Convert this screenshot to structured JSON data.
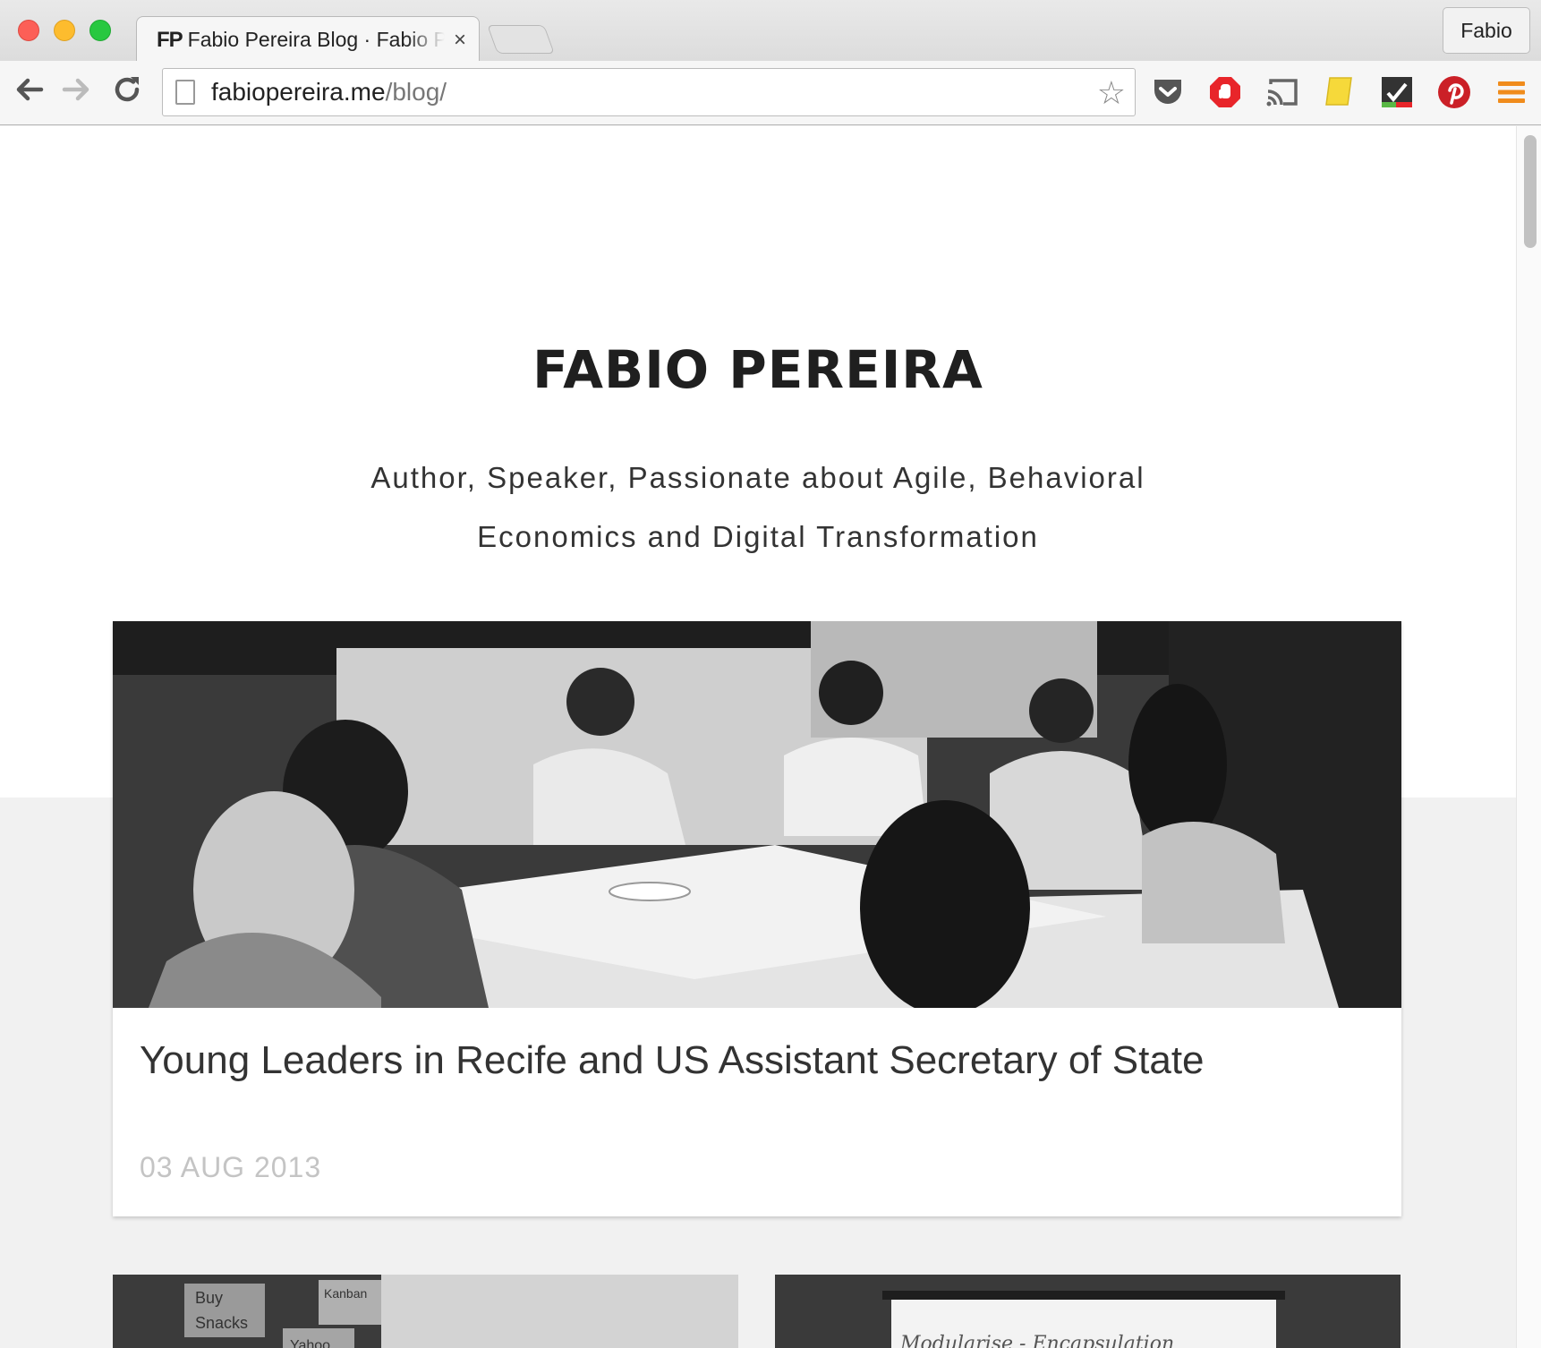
{
  "browser": {
    "tab": {
      "favicon_text": "FP",
      "title": "Fabio Pereira Blog · Fabio P",
      "close_label": "×"
    },
    "profile_name": "Fabio",
    "url_host": "fabiopereira.me",
    "url_path": "/blog/",
    "extensions": [
      "pocket-icon",
      "adblock-stop-icon",
      "cast-icon",
      "sticky-note-icon",
      "checklist-icon",
      "pinterest-icon",
      "menu-icon"
    ]
  },
  "site": {
    "title": "FABIO PEREIRA",
    "tagline": "Author, Speaker, Passionate about Agile, Behavioral Economics and Digital Transformation"
  },
  "featured_post": {
    "title": "Young Leaders in Recife and US Assistant Secretary of State",
    "date": "03 AUG 2013"
  },
  "more_posts": {
    "left_image_text": [
      "Buy",
      "Snacks",
      "Kanban",
      "Yahoo"
    ],
    "right_image_text": "Modularise - Encapsulation"
  },
  "colors": {
    "accent_red": "#e8252a",
    "pinterest": "#cb2027",
    "menu_orange": "#f08c1c",
    "title_text": "#1f1f1f",
    "date_text": "#c4c4c4"
  }
}
